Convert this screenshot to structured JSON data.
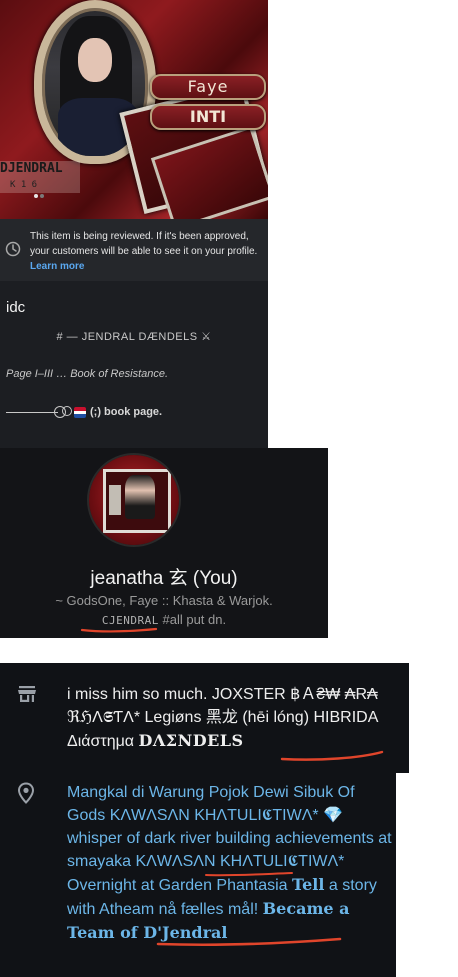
{
  "post": {
    "banner": {
      "name_pill": "Faye",
      "tag_pill": "INTI",
      "watermark": "DJENDRAL",
      "watermark_small": "K 1 6"
    },
    "review_notice": {
      "text": "This item is being reviewed. If it's been approved, your customers will be able to see it on your profile.",
      "link": "Learn more"
    },
    "caption": "idc",
    "title": "# — JENDRAL DÆNDELS ⚔",
    "subtitle": "Page I–III … Book of Resistance.",
    "book_page_label": "(;) book page.",
    "flag_colors": [
      "#c8102e",
      "#ffffff",
      "#1f4fa3"
    ]
  },
  "profile": {
    "name": "jeanatha 玄 (You)",
    "bio_line1": "~ GodsOne, Faye :: Khasta & Warjok.",
    "bio_tag": "CJENDRAL",
    "bio_line2_rest": " #all put dn."
  },
  "about": {
    "icon_store": "store-icon",
    "line_a": "i miss him so much. JOXSTER ฿Ａ₴₩ ₳R₳ ℜℌΛ𝕾ƬΛ* Legiøns 黑龙 (hēi lóng) HIBRIDA Διάστημα ",
    "line_a_end": "DΛΣNDELS",
    "icon_location": "location-pin-icon",
    "location_a": "Mangkal di Warung Pojok Dewi Sibuk Of Gods KΛWΛSΛN KHΛTULI𝕮TIWΛ* 💎 whisper of dark river building achievements at smayaka KΛWΛSΛN KHΛTULI𝕮TIWΛ* Overnight at Garden Phantasia ",
    "location_tell": "Tell",
    "location_b": " a story with Atheam nå fælles mål! ",
    "location_became": "Became a Team of D'Jendral"
  },
  "colors": {
    "accent_blue": "#6cb6e8",
    "link_blue": "#5aa8f0",
    "annotation_red": "#e0452b"
  }
}
